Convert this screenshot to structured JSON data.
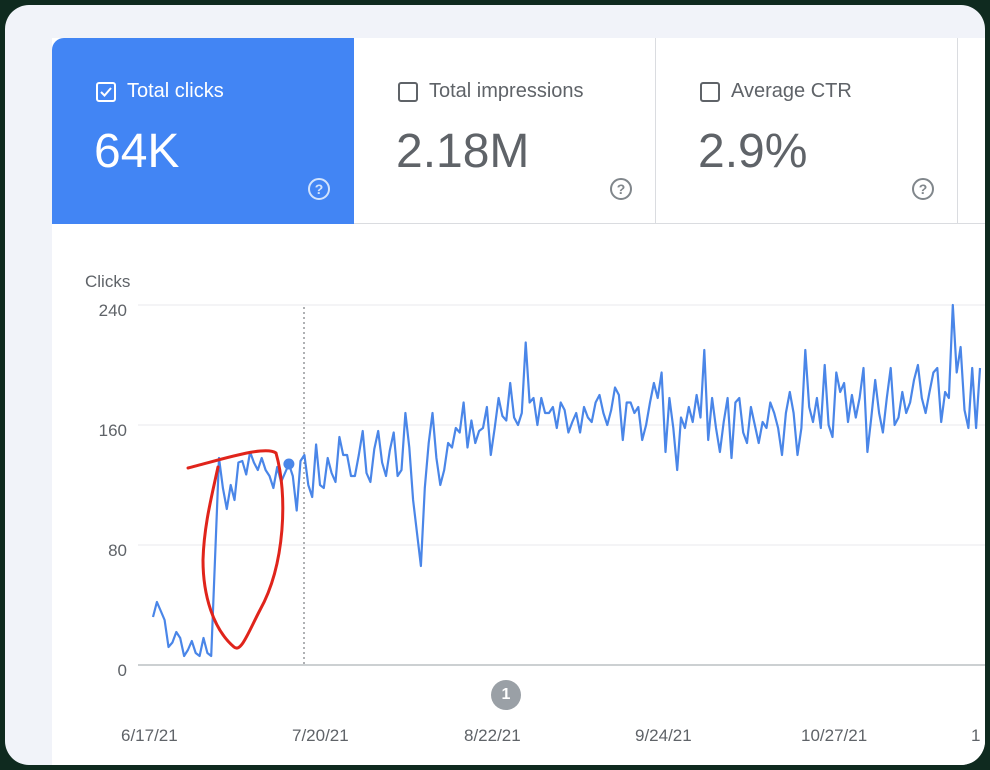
{
  "metrics": [
    {
      "label": "Total clicks",
      "value": "64K",
      "checked": true
    },
    {
      "label": "Total impressions",
      "value": "2.18M",
      "checked": false
    },
    {
      "label": "Average CTR",
      "value": "2.9%",
      "checked": false
    }
  ],
  "help_icon_text": "?",
  "annotation_badge": "1",
  "colors": {
    "accent": "#4285f4",
    "line": "#4a86e8",
    "highlight": "#e0241b"
  },
  "chart_data": {
    "type": "line",
    "ylabel": "Clicks",
    "ylim": [
      0,
      240
    ],
    "yticks": [
      "0",
      "80",
      "160",
      "240"
    ],
    "x_tick_labels": [
      "6/17/21",
      "7/20/21",
      "8/22/21",
      "9/24/21",
      "10/27/21",
      "1"
    ],
    "grid": true,
    "annotation_marker_date": "7/20/21",
    "series": [
      {
        "values": [
          32,
          42,
          36,
          30,
          12,
          15,
          22,
          18,
          6,
          10,
          16,
          8,
          6,
          18,
          8,
          6,
          72,
          138,
          118,
          104,
          120,
          110,
          135,
          136,
          127,
          142,
          135,
          130,
          138,
          130,
          126,
          118,
          132,
          122,
          128,
          134,
          126,
          103,
          136,
          140,
          120,
          112,
          147,
          120,
          118,
          138,
          128,
          122,
          152,
          140,
          140,
          126,
          126,
          140,
          156,
          128,
          122,
          144,
          156,
          135,
          126,
          143,
          155,
          126,
          130,
          168,
          145,
          110,
          88,
          66,
          118,
          148,
          168,
          138,
          120,
          130,
          148,
          145,
          158,
          155,
          175,
          145,
          163,
          148,
          156,
          158,
          172,
          140,
          158,
          178,
          166,
          163,
          188,
          165,
          160,
          168,
          215,
          175,
          178,
          160,
          178,
          168,
          168,
          172,
          158,
          175,
          170,
          155,
          162,
          168,
          155,
          172,
          165,
          162,
          175,
          180,
          168,
          160,
          170,
          185,
          180,
          150,
          175,
          175,
          168,
          172,
          150,
          160,
          175,
          188,
          178,
          195,
          142,
          178,
          158,
          130,
          165,
          158,
          172,
          162,
          180,
          165,
          210,
          150,
          178,
          158,
          142,
          162,
          178,
          138,
          175,
          178,
          155,
          148,
          172,
          160,
          148,
          162,
          158,
          175,
          168,
          158,
          140,
          168,
          182,
          168,
          140,
          158,
          210,
          172,
          162,
          178,
          158,
          200,
          160,
          152,
          195,
          182,
          188,
          162,
          180,
          165,
          178,
          198,
          142,
          165,
          190,
          168,
          155,
          178,
          198,
          160,
          165,
          182,
          168,
          175,
          190,
          200,
          178,
          168,
          182,
          195,
          198,
          162,
          182,
          178,
          240,
          195,
          212,
          170,
          158,
          198,
          158,
          198
        ]
      }
    ]
  }
}
